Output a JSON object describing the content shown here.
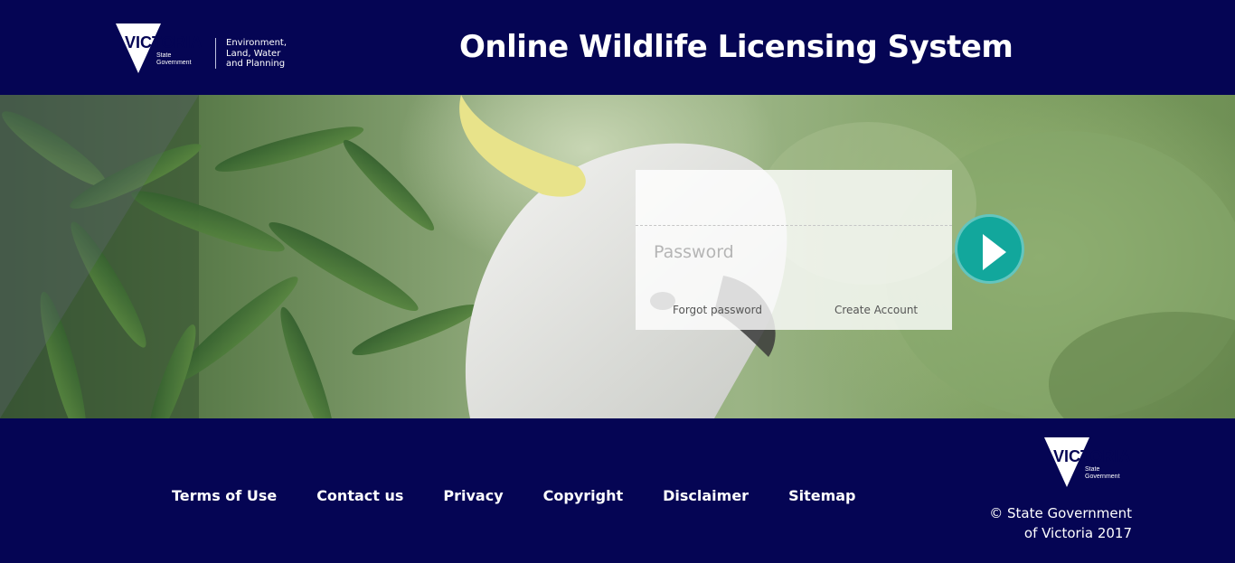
{
  "header": {
    "logo_wordmark": "VICTORIA",
    "logo_subtitle_1": "State",
    "logo_subtitle_2": "Government",
    "department_lines": [
      "Environment,",
      "Land, Water",
      "and Planning"
    ],
    "title": "Online Wildlife Licensing System"
  },
  "login": {
    "username_placeholder": "",
    "password_placeholder": "Password",
    "forgot_label": "Forgot password",
    "create_label": "Create Account",
    "submit_icon": "play-arrow-icon"
  },
  "footer": {
    "links": [
      "Terms of Use",
      "Contact us",
      "Privacy",
      "Copyright",
      "Disclaimer",
      "Sitemap"
    ],
    "logo_wordmark": "VICTORIA",
    "logo_subtitle_1": "State",
    "logo_subtitle_2": "Government",
    "copyright_line_1": "© State Government",
    "copyright_line_2": "of Victoria 2017"
  },
  "colors": {
    "navy": "#050554",
    "accent_teal": "#12a79c",
    "panel_white": "rgba(255,255,255,0.80)"
  }
}
